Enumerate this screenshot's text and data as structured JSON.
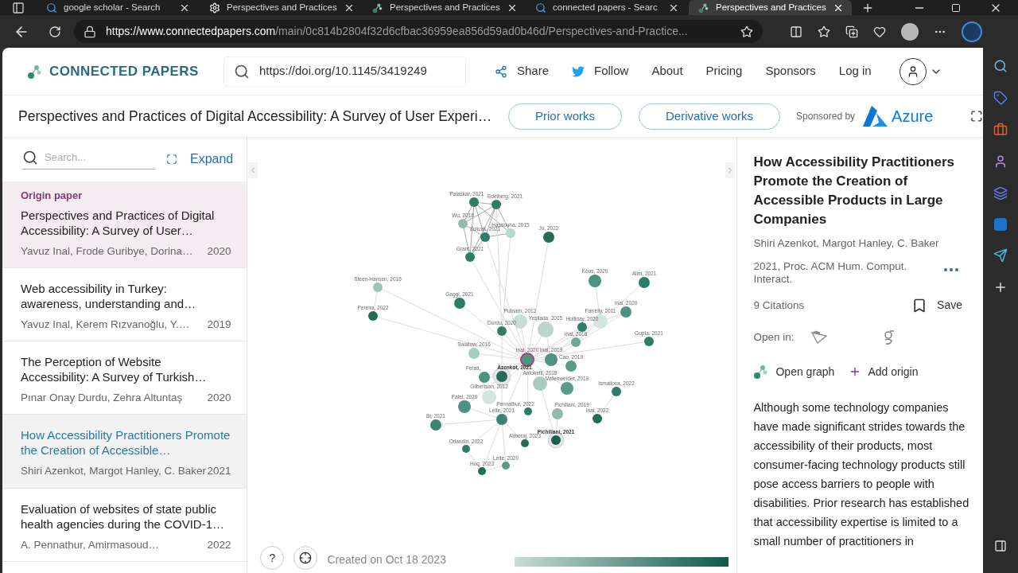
{
  "browser": {
    "tabs": [
      {
        "title": "google scholar - Search",
        "kind": "search",
        "selected": false
      },
      {
        "title": "Perspectives and Practices",
        "kind": "gear",
        "selected": false
      },
      {
        "title": "Perspectives and Practices",
        "kind": "graph",
        "selected": false
      },
      {
        "title": "connected papers - Searc",
        "kind": "search",
        "selected": false
      },
      {
        "title": "Perspectives and Practices",
        "kind": "graph",
        "selected": true
      }
    ],
    "url_host": "https://www.connectedpapers.com",
    "url_path": "/main/0c814b2804f32d6cfbac36959ea856d59ad0b46d/Perspectives-and-Practice..."
  },
  "header": {
    "logo": "CONNECTED PAPERS",
    "search_value": "https://doi.org/10.1145/3419249",
    "nav": [
      {
        "label": "Share",
        "kind": "share"
      },
      {
        "label": "Follow",
        "kind": "follow"
      },
      {
        "label": "About",
        "kind": "plain"
      },
      {
        "label": "Pricing",
        "kind": "plain"
      },
      {
        "label": "Sponsors",
        "kind": "plain"
      },
      {
        "label": "Log in",
        "kind": "plain"
      }
    ]
  },
  "title_bar": {
    "title": "Perspectives and Practices of Digital Accessibility: A Survey of User Experi…",
    "buttons": [
      "Prior works",
      "Derivative works"
    ],
    "sponsor_label": "Sponsored by",
    "sponsor": "Azure"
  },
  "list": {
    "search_placeholder": "Search...",
    "expand": "Expand",
    "origin_label": "Origin paper",
    "papers": [
      {
        "title": "Perspectives and Practices of Digital Accessibility: A Survey of User…",
        "authors": "Yavuz Inal, Frode Guribye, Dorina…",
        "year": "2020",
        "origin": true,
        "selected": false
      },
      {
        "title": "Web accessibility in Turkey: awareness, understanding and…",
        "authors": "Yavuz Inal, Kerem Rızvanoğlu, Y.…",
        "year": "2019",
        "origin": false,
        "selected": false
      },
      {
        "title": "The Perception of Website Accessibility: A Survey of Turkish…",
        "authors": "Pınar Onay Durdu, Zehra Altuntaş",
        "year": "2020",
        "origin": false,
        "selected": false
      },
      {
        "title": "How Accessibility Practitioners Promote the Creation of Accessible…",
        "authors": "Shiri Azenkot, Margot Hanley, C. Baker",
        "year": "2021",
        "origin": false,
        "selected": true
      },
      {
        "title": "Evaluation of websites of state public health agencies during the COVID-1…",
        "authors": "A. Pennathur, Amirmasoud…",
        "year": "2022",
        "origin": false,
        "selected": false
      }
    ]
  },
  "graph": {
    "nodes": [
      {
        "label": "Palaskar, 2021",
        "color": "#2e7d68",
        "origin": false,
        "selected": false
      },
      {
        "label": "Edelberg, 2021",
        "color": "#2e7d68",
        "origin": false,
        "selected": false
      },
      {
        "label": "Wu, 2018",
        "color": "#8fbcae",
        "origin": false,
        "selected": false
      },
      {
        "label": "Hassouna, 2015",
        "color": "#b9d6cc",
        "origin": false,
        "selected": false
      },
      {
        "label": "Zulicek, 2021",
        "color": "#2e7d68",
        "origin": false,
        "selected": false
      },
      {
        "label": "Grant, 2021",
        "color": "#2e7d68",
        "origin": false,
        "selected": false
      },
      {
        "label": "Jo, 2022",
        "color": "#246b58",
        "origin": false,
        "selected": false
      },
      {
        "label": "Steen-Hansen, 2016",
        "color": "#9cc4b8",
        "origin": false,
        "selected": false
      },
      {
        "label": "Pereira, 2022",
        "color": "#246b58",
        "origin": false,
        "selected": false
      },
      {
        "label": "Gaggi, 2021",
        "color": "#2e7d68",
        "origin": false,
        "selected": false
      },
      {
        "label": "Kous, 2020",
        "color": "#4e9281",
        "origin": false,
        "selected": false
      },
      {
        "label": "Alim, 2021",
        "color": "#2e7d68",
        "origin": false,
        "selected": false
      },
      {
        "label": "Inal, 2020",
        "color": "#4e9281",
        "origin": false,
        "selected": false
      },
      {
        "label": "Putnam, 2012",
        "color": "#c8ddd6",
        "origin": false,
        "selected": false
      },
      {
        "label": "Yeşilada, 2015",
        "color": "#b9d6cc",
        "origin": false,
        "selected": false
      },
      {
        "label": "Farrelly, 2011",
        "color": "#d3e5df",
        "origin": false,
        "selected": false
      },
      {
        "label": "Holliday, 2020",
        "color": "#2e7d68",
        "origin": false,
        "selected": false
      },
      {
        "label": "Durdu, 2020",
        "color": "#2e7d68",
        "origin": false,
        "selected": false
      },
      {
        "label": "Inal, 2018",
        "color": "#6ea797",
        "origin": false,
        "selected": false
      },
      {
        "label": "Gupta, 2021",
        "color": "#2e7d68",
        "origin": false,
        "selected": false
      },
      {
        "label": "Swallow, 2016",
        "color": "#a9ccc1",
        "origin": false,
        "selected": false
      },
      {
        "label": "Inal, 2020",
        "color": "#4e9281",
        "origin": true,
        "selected": false
      },
      {
        "label": "Inal, 2019",
        "color": "#4e9281",
        "origin": false,
        "selected": false
      },
      {
        "label": "Cao, 2019",
        "color": "#5a9a88",
        "origin": false,
        "selected": false
      },
      {
        "label": "Ferati,",
        "color": "#4e9281",
        "origin": false,
        "selected": false
      },
      {
        "label": "Azenkot, 2021",
        "color": "#246b58",
        "origin": false,
        "selected": true
      },
      {
        "label": "Antonelli, 2018",
        "color": "#a9ccc1",
        "origin": false,
        "selected": false
      },
      {
        "label": "Vollenweider, 2019",
        "color": "#5a9a88",
        "origin": false,
        "selected": false
      },
      {
        "label": "Gilbertson, 2012",
        "color": "#d3e5df",
        "origin": false,
        "selected": false
      },
      {
        "label": "Ismailova, 2022",
        "color": "#2e7d68",
        "origin": false,
        "selected": false
      },
      {
        "label": "Patel, 2020",
        "color": "#4e9281",
        "origin": false,
        "selected": false
      },
      {
        "label": "Pennathur, 2022",
        "color": "#2e7d68",
        "origin": false,
        "selected": false
      },
      {
        "label": "Pichiliani, 2019",
        "color": "#8fbcae",
        "origin": false,
        "selected": false
      },
      {
        "label": "Leite, 2021",
        "color": "#3d8573",
        "origin": false,
        "selected": false
      },
      {
        "label": "Inal, 2022",
        "color": "#246b58",
        "origin": false,
        "selected": false
      },
      {
        "label": "Bi, 2021",
        "color": "#3d8573",
        "origin": false,
        "selected": false
      },
      {
        "label": "Almeraj, 2023",
        "color": "#246b58",
        "origin": false,
        "selected": false
      },
      {
        "label": "Pichiliani, 2021",
        "color": "#1f5e4e",
        "origin": false,
        "selected": true
      },
      {
        "label": "Orlandin, 2022",
        "color": "#2e7d68",
        "origin": false,
        "selected": false
      },
      {
        "label": "Leite, 2020",
        "color": "#5a9a88",
        "origin": false,
        "selected": false
      },
      {
        "label": "Huq, 2023",
        "color": "#246b58",
        "origin": false,
        "selected": false
      }
    ],
    "help": "?",
    "created": "Created on Oct 18 2023"
  },
  "details": {
    "title": "How Accessibility Practitioners Promote the Creation of Accessible Products in Large Companies",
    "authors": "Shiri Azenkot, Margot Hanley, C. Baker",
    "venue": "2021, Proc. ACM Hum. Comput. Interact.",
    "citations": "9 Citations",
    "save": "Save",
    "open_in": "Open in:",
    "open_graph": "Open graph",
    "add_origin": "Add origin",
    "abstract": "Although some technology companies have made significant strides towards the accessibility of their products, most consumer-facing technology products still pose access barriers to people with disabilities. Prior research has established that accessibility expertise is limited to a small number of practitioners in"
  }
}
